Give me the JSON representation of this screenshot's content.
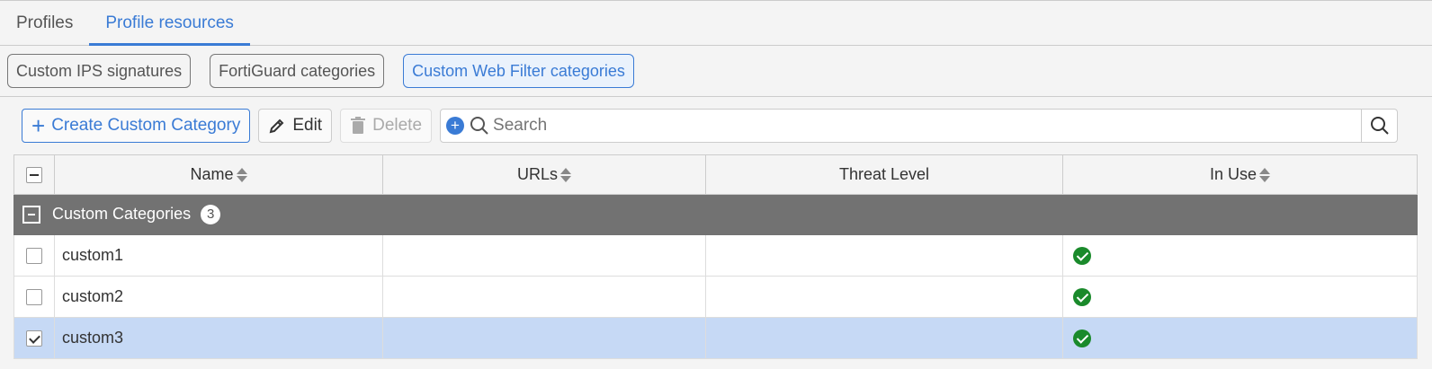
{
  "tabs": [
    {
      "label": "Profiles",
      "active": false
    },
    {
      "label": "Profile resources",
      "active": true
    }
  ],
  "subtabs": [
    {
      "label": "Custom IPS signatures",
      "active": false
    },
    {
      "label": "FortiGuard categories",
      "active": false
    },
    {
      "label": "Custom Web Filter categories",
      "active": true
    }
  ],
  "toolbar": {
    "create_label": "Create Custom Category",
    "edit_label": "Edit",
    "delete_label": "Delete",
    "search_placeholder": "Search"
  },
  "table": {
    "columns": [
      "Name",
      "URLs",
      "Threat Level",
      "In Use"
    ],
    "group": {
      "label": "Custom Categories",
      "count": "3"
    },
    "rows": [
      {
        "name": "custom1",
        "urls": "",
        "threat": "",
        "in_use": true,
        "selected": false
      },
      {
        "name": "custom2",
        "urls": "",
        "threat": "",
        "in_use": true,
        "selected": false
      },
      {
        "name": "custom3",
        "urls": "",
        "threat": "",
        "in_use": true,
        "selected": true
      }
    ]
  },
  "colors": {
    "accent": "#3a7bd5",
    "ok": "#1a8a2b",
    "group_bg": "#727272",
    "selected_bg": "#c6d9f5"
  }
}
